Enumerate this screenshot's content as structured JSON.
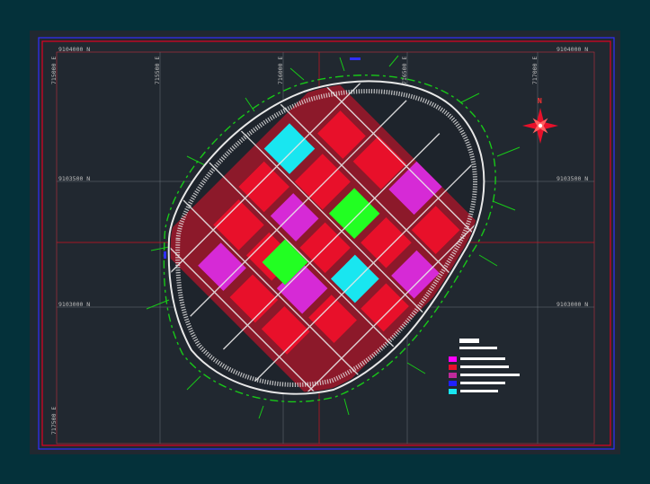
{
  "map": {
    "grid_labels": {
      "north": [
        "9104000 N",
        "9103500 N",
        "9103000 N"
      ],
      "east": [
        "715000 E",
        "715500 E",
        "716000 E",
        "716500 E",
        "717000 E",
        "717500 E"
      ]
    },
    "north_arrow_label": "N",
    "colors": {
      "background": "#04313a",
      "sheet": "#212830",
      "frame_red": "#e00020",
      "frame_blue": "#3030ff",
      "blocks_red": "#e8102a",
      "blocks_magenta": "#d62ad6",
      "blocks_cyan": "#19e6f0",
      "blocks_green": "#22ff22",
      "streets": "#e8e8e8",
      "vegetation": "#18c818"
    },
    "legend_swatch_colors": [
      "#ffffff",
      "#ff00ff",
      "#e8102a",
      "#c02a9a",
      "#2020ff",
      "#18e6f0"
    ]
  }
}
